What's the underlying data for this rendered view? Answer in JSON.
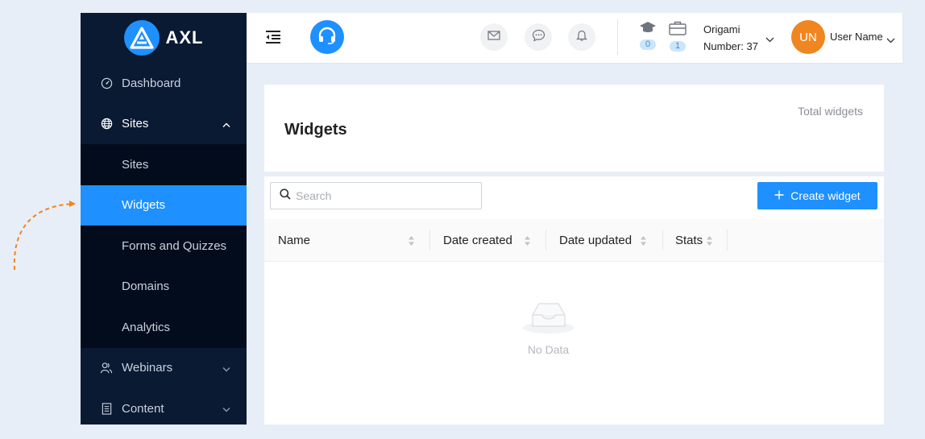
{
  "brand": {
    "name": "AXL",
    "accent": "#1e90ff",
    "sidebar_bg": "#0a1a33"
  },
  "sidebar": {
    "items": [
      {
        "label": "Dashboard",
        "icon": "dashboard-icon"
      },
      {
        "label": "Sites",
        "icon": "globe-icon",
        "expanded": true
      },
      {
        "label": "Webinars",
        "icon": "users-icon"
      },
      {
        "label": "Content",
        "icon": "document-icon"
      }
    ],
    "sites_submenu": [
      "Sites",
      "Widgets",
      "Forms and Quizzes",
      "Domains",
      "Analytics"
    ],
    "active": "Widgets"
  },
  "header": {
    "course_count": "0",
    "project_count": "1",
    "project": {
      "name": "Origami",
      "number": "Number: 37"
    },
    "user": {
      "initials": "UN",
      "name": "User Name",
      "avatar_color": "#ef8621"
    }
  },
  "page": {
    "title": "Widgets",
    "total_label": "Total widgets"
  },
  "table": {
    "search_placeholder": "Search",
    "create_label": "Create widget",
    "columns": [
      "Name",
      "Date created",
      "Date updated",
      "Stats"
    ],
    "empty_text": "No Data"
  }
}
